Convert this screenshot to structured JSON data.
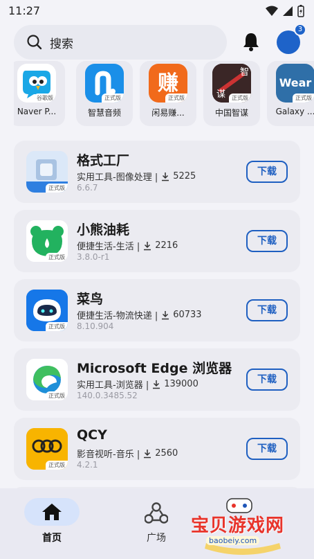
{
  "status_bar": {
    "time": "11:27"
  },
  "search": {
    "placeholder": "搜索"
  },
  "notification_badge": "3",
  "strip": [
    {
      "name": "Naver P...",
      "tag": "谷歌版",
      "icon": "naver-papago-icon"
    },
    {
      "name": "智慧音频",
      "tag": "正式版",
      "icon": "smart-audio-icon"
    },
    {
      "name": "闲易赚...",
      "tag": "正式版",
      "icon": "xianyizhuan-icon"
    },
    {
      "name": "中国智谋",
      "tag": "正式版",
      "icon": "zhongguo-zhimou-icon"
    },
    {
      "name": "Galaxy ...",
      "tag": "正式版",
      "icon": "galaxy-wear-icon"
    }
  ],
  "apps": [
    {
      "name": "格式工厂",
      "category": "实用工具-图像处理 |",
      "downloads": "5225",
      "version": "6.6.7",
      "tag": "正式版",
      "icon": "format-factory-icon"
    },
    {
      "name": "小熊油耗",
      "category": "便捷生活-生活 |",
      "downloads": "2216",
      "version": "3.8.0-r1",
      "tag": "正式版",
      "icon": "bear-fuel-icon"
    },
    {
      "name": "菜鸟",
      "category": "便捷生活-物流快递 |",
      "downloads": "60733",
      "version": "8.10.904",
      "tag": "正式版",
      "icon": "cainiao-icon"
    },
    {
      "name": "Microsoft Edge 浏览器",
      "category": "实用工具-浏览器 |",
      "downloads": "139000",
      "version": "140.0.3485.52",
      "tag": "正式版",
      "icon": "microsoft-edge-icon"
    },
    {
      "name": "QCY",
      "category": "影音视听-音乐 |",
      "downloads": "2560",
      "version": "4.2.1",
      "tag": "正式版",
      "icon": "qcy-icon"
    }
  ],
  "download_label": "下载",
  "nav": {
    "home": "首页",
    "plaza": "广场"
  },
  "watermark": {
    "text": "宝贝游戏网",
    "url": "baobeiy.com"
  },
  "colors": {
    "accent": "#1e5fc1",
    "background": "#f3f3f8",
    "card": "#ebebf1"
  }
}
